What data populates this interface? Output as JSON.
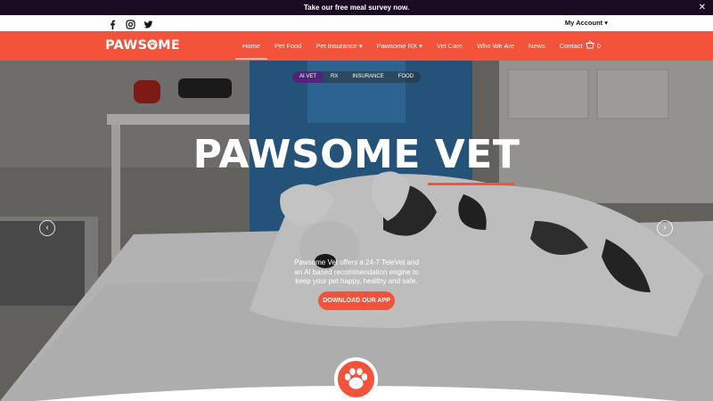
{
  "announcement": {
    "text": "Take our free meal survey now.",
    "close": "✕"
  },
  "social": [
    "facebook-icon",
    "instagram-icon",
    "twitter-icon"
  ],
  "account": {
    "label": "My Account ▾"
  },
  "brand": {
    "name": "PAWSOME",
    "accent": "#f3533a",
    "dark": "#1a0a24",
    "purple": "#4e2578"
  },
  "nav": {
    "items": [
      "Home",
      "Pet Food",
      "Pet Insurance ▾",
      "Pawsome RX ▾",
      "Vet Care",
      "Who We Are",
      "News",
      "Contact"
    ],
    "cart_count": "0"
  },
  "hero": {
    "tabs": [
      "AI VET",
      "RX",
      "INSURANCE",
      "FOOD"
    ],
    "title": "PAWSOME VET",
    "description": "Pawsome Vet offers a 24-7 TeleVet and an AI based recommendation engine to keep your pet happy, healthy and safe.",
    "cta": "DOWNLOAD OUR APP",
    "prev": "‹",
    "next": "›"
  }
}
